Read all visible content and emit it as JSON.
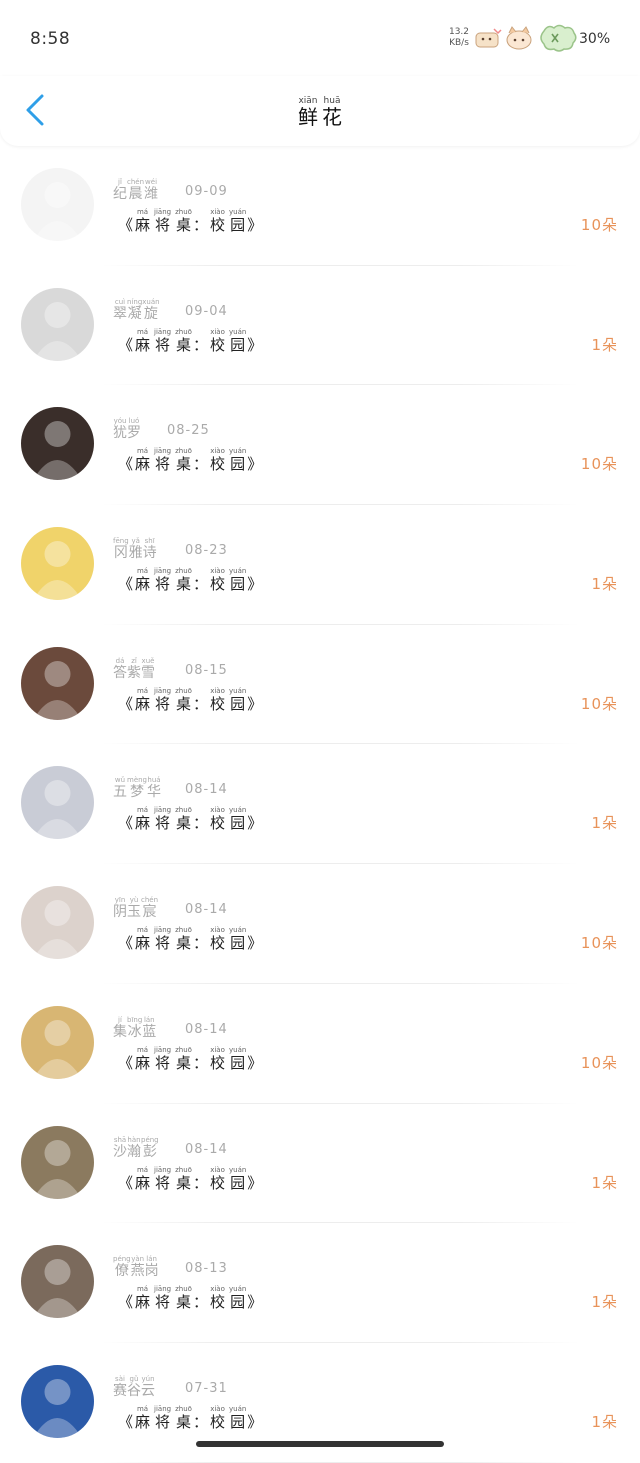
{
  "status_bar": {
    "time": "8:58",
    "net_speed_value": "13.2",
    "net_speed_unit": "KB/s",
    "battery_percent": "30%"
  },
  "header": {
    "back_icon": "chevron-left-icon",
    "title_chars": [
      {
        "char": "鲜",
        "pinyin": "xiān"
      },
      {
        "char": "花",
        "pinyin": "huā"
      }
    ]
  },
  "book_title": {
    "open": "《",
    "chars": [
      {
        "char": "麻",
        "pinyin": "má"
      },
      {
        "char": "将",
        "pinyin": "jiāng"
      },
      {
        "char": "桌",
        "pinyin": "zhuō"
      }
    ],
    "sep": "：",
    "chars2": [
      {
        "char": "校",
        "pinyin": "xiào"
      },
      {
        "char": "园",
        "pinyin": "yuán"
      }
    ],
    "close": "》"
  },
  "colors": {
    "accent_back": "#2f9fe8",
    "count": "#e8935a",
    "muted_text": "#aaaaaa"
  },
  "items": [
    {
      "name": [
        {
          "char": "纪",
          "pinyin": "jǐ"
        },
        {
          "char": "晨",
          "pinyin": "chén"
        },
        {
          "char": "潍",
          "pinyin": "wéi"
        }
      ],
      "date": "09-09",
      "count": "10朵",
      "avatar_bg": "#f4f4f4"
    },
    {
      "name": [
        {
          "char": "翠",
          "pinyin": "cuì"
        },
        {
          "char": "凝",
          "pinyin": "níng"
        },
        {
          "char": "旋",
          "pinyin": "xuán"
        }
      ],
      "date": "09-04",
      "count": "1朵",
      "avatar_bg": "#d9d9d9"
    },
    {
      "name": [
        {
          "char": "犹",
          "pinyin": "yóu"
        },
        {
          "char": "罗",
          "pinyin": "luó"
        }
      ],
      "date": "08-25",
      "count": "10朵",
      "avatar_bg": "#3a2e2a"
    },
    {
      "name": [
        {
          "char": "冈",
          "pinyin": "fēng"
        },
        {
          "char": "雅",
          "pinyin": "yǎ"
        },
        {
          "char": "诗",
          "pinyin": "shī"
        }
      ],
      "date": "08-23",
      "count": "1朵",
      "avatar_bg": "#f0d36a"
    },
    {
      "name": [
        {
          "char": "答",
          "pinyin": "dá"
        },
        {
          "char": "紫",
          "pinyin": "zǐ"
        },
        {
          "char": "雪",
          "pinyin": "xuě"
        }
      ],
      "date": "08-15",
      "count": "10朵",
      "avatar_bg": "#6b4a3c"
    },
    {
      "name": [
        {
          "char": "五",
          "pinyin": "wǔ"
        },
        {
          "char": "梦",
          "pinyin": "mèng"
        },
        {
          "char": "华",
          "pinyin": "huá"
        }
      ],
      "date": "08-14",
      "count": "1朵",
      "avatar_bg": "#c9ccd6"
    },
    {
      "name": [
        {
          "char": "阴",
          "pinyin": "yīn"
        },
        {
          "char": "玉",
          "pinyin": "yù"
        },
        {
          "char": "宸",
          "pinyin": "chén"
        }
      ],
      "date": "08-14",
      "count": "10朵",
      "avatar_bg": "#dcd2cc"
    },
    {
      "name": [
        {
          "char": "集",
          "pinyin": "jí"
        },
        {
          "char": "冰",
          "pinyin": "bīng"
        },
        {
          "char": "蓝",
          "pinyin": "lán"
        }
      ],
      "date": "08-14",
      "count": "10朵",
      "avatar_bg": "#d8b673"
    },
    {
      "name": [
        {
          "char": "沙",
          "pinyin": "shā"
        },
        {
          "char": "瀚",
          "pinyin": "hàn"
        },
        {
          "char": "彭",
          "pinyin": "péng"
        }
      ],
      "date": "08-14",
      "count": "1朵",
      "avatar_bg": "#8b7a5f"
    },
    {
      "name": [
        {
          "char": "僚",
          "pinyin": "péng"
        },
        {
          "char": "燕",
          "pinyin": "yàn"
        },
        {
          "char": "岗",
          "pinyin": "lán"
        }
      ],
      "date": "08-13",
      "count": "1朵",
      "avatar_bg": "#7b6a5c"
    },
    {
      "name": [
        {
          "char": "赛",
          "pinyin": "sài"
        },
        {
          "char": "谷",
          "pinyin": "gǔ"
        },
        {
          "char": "云",
          "pinyin": "yún"
        }
      ],
      "date": "07-31",
      "count": "1朵",
      "avatar_bg": "#2b5aa8"
    }
  ]
}
